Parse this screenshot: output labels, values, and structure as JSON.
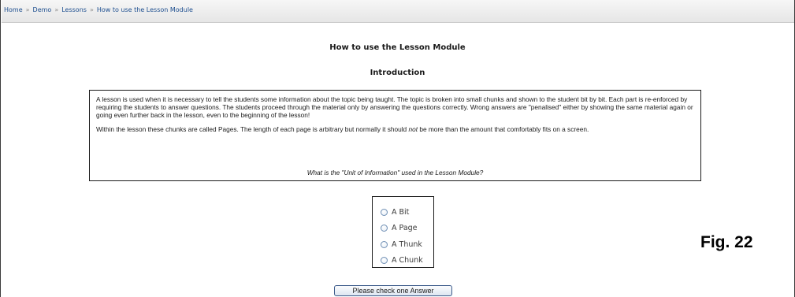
{
  "breadcrumb": {
    "items": [
      "Home",
      "Demo",
      "Lessons",
      "How to use the Lesson Module"
    ],
    "separator": "»"
  },
  "page_title": "How to use the Lesson Module",
  "section_title": "Introduction",
  "content": {
    "paragraph1": "A lesson is used when it is necessary to tell the students some information about the topic being taught. The topic is broken into small chunks and shown to the student bit by bit. Each part is re-enforced by requiring the students to answer questions. The students proceed through the material only by answering the questions correctly. Wrong answers are \"penalised\" either by showing the same material again or going even further back in the lesson, even to the beginning of the lesson!",
    "paragraph2_before": "Within the lesson these chunks are called Pages. The length of each page is arbitrary but normally it should ",
    "paragraph2_emphasis": "not",
    "paragraph2_after": " be more than the amount that comfortably fits on a screen.",
    "question": "What is the \"Unit of Information\" used in the Lesson Module?"
  },
  "options": [
    "A Bit",
    "A Page",
    "A Thunk",
    "A Chunk"
  ],
  "submit_label": "Please check one Answer",
  "figure_label": "Fig. 22"
}
